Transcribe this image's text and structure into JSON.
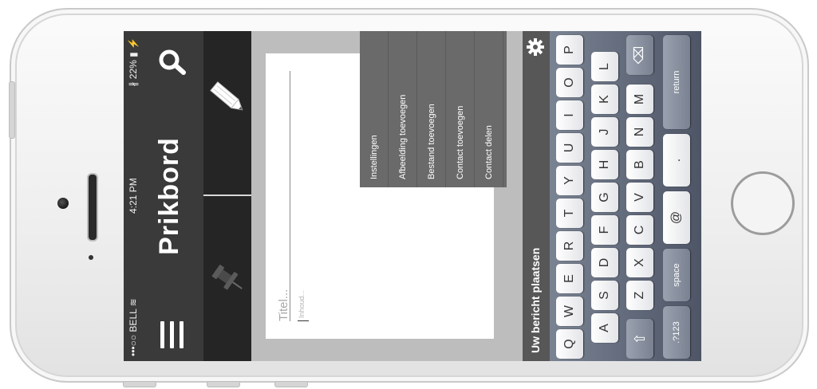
{
  "status_bar": {
    "carrier": "•••○○ BELL ≋",
    "time": "4:21 PM",
    "battery": "∦ 22% ▮ ⚡"
  },
  "header": {
    "title": "Prikbord",
    "menu_icon": "hamburger-menu-icon",
    "search_icon": "search-icon"
  },
  "toolbar": {
    "left_icon": "pushpin-icon",
    "right_icon": "pencil-icon"
  },
  "note": {
    "title_placeholder": "Titel...",
    "text_placeholder": "Inhoud..."
  },
  "dropdown_menu": {
    "items": [
      "Instellingen",
      "Afbeelding toevoegen",
      "Bestand toevoegen",
      "Contact toevoegen",
      "Contact delen"
    ]
  },
  "bottom_bar": {
    "label": "Uw bericht plaatsen",
    "settings_icon": "gear-icon"
  },
  "keyboard": {
    "row1": [
      "Q",
      "W",
      "E",
      "R",
      "T",
      "Y",
      "U",
      "I",
      "O",
      "P"
    ],
    "row2": [
      "A",
      "S",
      "D",
      "F",
      "G",
      "H",
      "J",
      "K",
      "L"
    ],
    "row3": [
      "Z",
      "X",
      "C",
      "V",
      "B",
      "N",
      "M"
    ],
    "shift": "⇧",
    "backspace": "⌫",
    "numbers": ".?123",
    "space": "space",
    "at": "@",
    "dot": ".",
    "return": "return"
  }
}
